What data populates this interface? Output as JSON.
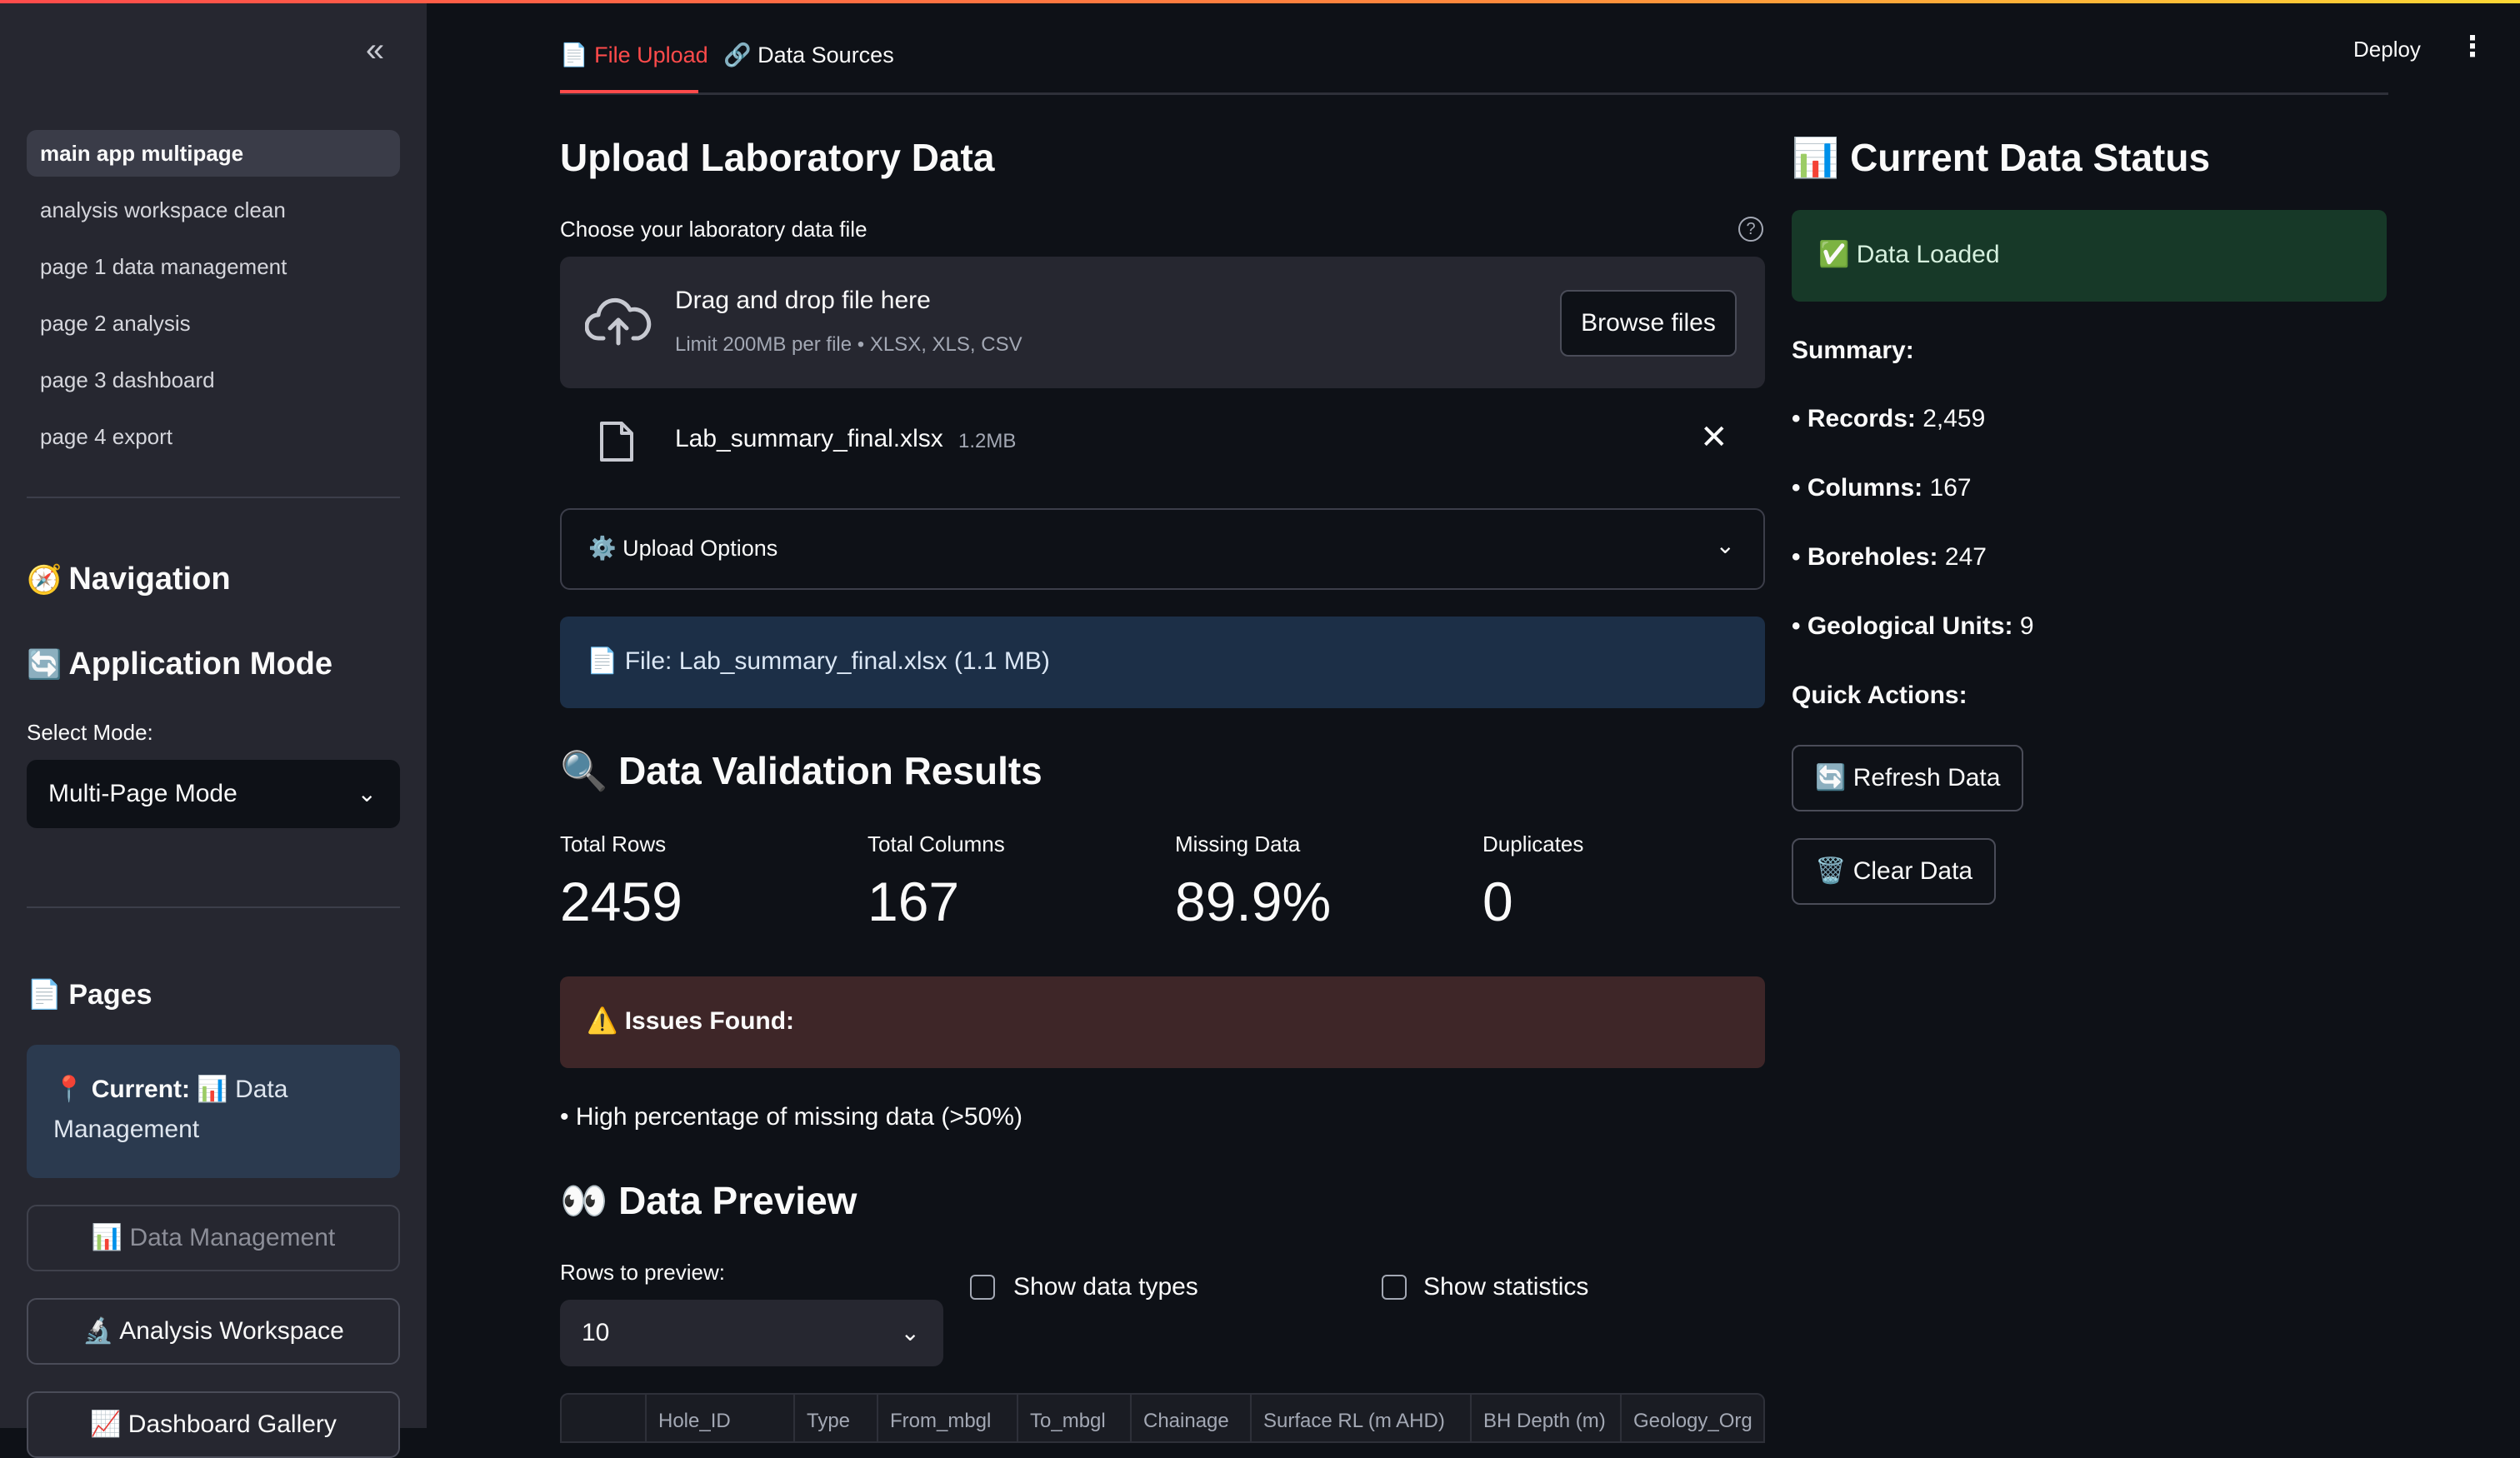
{
  "app": {
    "deploy_label": "Deploy",
    "menu_icon": "kebab-menu-icon",
    "collapse_icon": "double-chevron-left-icon"
  },
  "sidebar": {
    "pages": [
      {
        "label": "main app multipage",
        "active": true
      },
      {
        "label": "analysis workspace clean",
        "active": false
      },
      {
        "label": "page 1 data management",
        "active": false
      },
      {
        "label": "page 2 analysis",
        "active": false
      },
      {
        "label": "page 3 dashboard",
        "active": false
      },
      {
        "label": "page 4 export",
        "active": false
      }
    ],
    "navigation_title": "Navigation",
    "navigation_icon": "🧭",
    "mode_title": "Application Mode",
    "mode_icon": "🔄",
    "mode_select_label": "Select Mode:",
    "mode_value": "Multi-Page Mode",
    "pages_title": "Pages",
    "pages_icon": "📄",
    "current_prefix": "📍 Current:",
    "current_value": "📊 Data Management",
    "buttons": [
      {
        "label": "📊 Data Management",
        "disabled": true
      },
      {
        "label": "🔬 Analysis Workspace",
        "disabled": false
      },
      {
        "label": "📈 Dashboard Gallery",
        "disabled": false
      }
    ]
  },
  "tabs": [
    {
      "label": "📄 File Upload",
      "active": true
    },
    {
      "label": "🔗 Data Sources",
      "active": false
    }
  ],
  "upload": {
    "title": "Upload Laboratory Data",
    "file_label": "Choose your laboratory data file",
    "dropzone_title": "Drag and drop file here",
    "dropzone_limit": "Limit 200MB per file • XLSX, XLS, CSV",
    "browse_label": "Browse files",
    "file_name": "Lab_summary_final.xlsx",
    "file_size": "1.2MB",
    "options_label": "⚙️ Upload Options",
    "info_text": "📄 File: Lab_summary_final.xlsx (1.1 MB)"
  },
  "validation": {
    "title": "Data Validation Results",
    "icon": "🔍",
    "metrics": [
      {
        "label": "Total Rows",
        "value": "2459"
      },
      {
        "label": "Total Columns",
        "value": "167"
      },
      {
        "label": "Missing Data",
        "value": "89.9%"
      },
      {
        "label": "Duplicates",
        "value": "0"
      }
    ],
    "issues_label": "⚠️ Issues Found:",
    "issue_item": "• High percentage of missing data (>50%)"
  },
  "preview": {
    "title": "Data Preview",
    "icon": "👀",
    "rows_label": "Rows to preview:",
    "rows_value": "10",
    "show_types_label": "Show data types",
    "show_stats_label": "Show statistics",
    "columns": [
      "Hole_ID",
      "Type",
      "From_mbgl",
      "To_mbgl",
      "Chainage",
      "Surface RL (m AHD)",
      "BH Depth (m)",
      "Geology_Org"
    ]
  },
  "status": {
    "title": "Current Data Status",
    "icon": "📊",
    "loaded_text": "✅ Data Loaded",
    "summary_label": "Summary:",
    "items": [
      {
        "key": "• Records:",
        "value": "2,459"
      },
      {
        "key": "• Columns:",
        "value": "167"
      },
      {
        "key": "• Boreholes:",
        "value": "247"
      },
      {
        "key": "• Geological Units:",
        "value": "9"
      }
    ],
    "quick_actions_label": "Quick Actions:",
    "refresh_label": "🔄 Refresh Data",
    "clear_label": "🗑️ Clear Data"
  }
}
